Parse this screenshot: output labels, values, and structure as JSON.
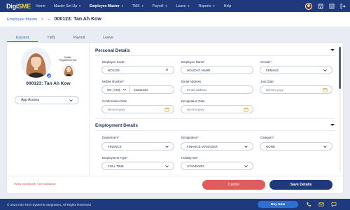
{
  "app": {
    "logo_prefix": "Digi",
    "logo_suffix": "SME",
    "colors": {
      "nav": "#1f3a7c",
      "accent": "#2d6fd3",
      "cancel": "#e05c5c",
      "required": "#d94242"
    }
  },
  "nav": {
    "items": [
      {
        "label": "Home",
        "has_caret": false
      },
      {
        "label": "Master Set Up",
        "has_caret": true
      },
      {
        "label": "Employee Master",
        "has_caret": true,
        "active": true
      },
      {
        "label": "TMS",
        "has_caret": true
      },
      {
        "label": "Payroll",
        "has_caret": true
      },
      {
        "label": "Leave",
        "has_caret": true
      },
      {
        "label": "Reports",
        "has_caret": true
      },
      {
        "label": "Help",
        "has_caret": false
      }
    ],
    "right_icons": [
      "user-avatar",
      "building-icon",
      "list-icon",
      "logout-icon"
    ]
  },
  "breadcrumb": {
    "parent": "Employee Master",
    "separator": ">",
    "title": "000123: Tan Ah Kow"
  },
  "tabs": [
    {
      "label": "Expand",
      "active": true
    },
    {
      "label": "TMS"
    },
    {
      "label": "Payroll"
    },
    {
      "label": "Leave"
    }
  ],
  "profile": {
    "reg_label": "Mobile Registered Face",
    "name": "000123: Tan Ah Kow",
    "app_access": "App Access"
  },
  "personal": {
    "title": "Personal Details",
    "employee_code": {
      "label": "Employee Code",
      "value": "NO1234"
    },
    "employee_name": {
      "label": "Employee Name",
      "value": "HOLIDAY NAME"
    },
    "gender": {
      "label": "Gender",
      "value": "FEMALE"
    },
    "mobile": {
      "label": "Mobile Number",
      "code": "SG (+65)",
      "value": "12341234"
    },
    "email": {
      "label": "Email Address",
      "placeholder": "Email address"
    },
    "join_date": {
      "label": "Join Date",
      "placeholder": "dd-mm-yyyy"
    },
    "confirmation_date": {
      "label": "Confirmation Date",
      "placeholder": "dd-mm-yyyy"
    },
    "resignation_date": {
      "label": "Resignation Date",
      "placeholder": "dd-mm-yyyy"
    }
  },
  "employment": {
    "title": "Employment Details",
    "department": {
      "label": "Department",
      "value": "FINANCE"
    },
    "designation": {
      "label": "Designation",
      "value": "FINANCE MANAGER"
    },
    "category": {
      "label": "Category",
      "value": "NONE"
    },
    "employment_type": {
      "label": "Employment Type",
      "value": "FULL TIME"
    },
    "holiday_set": {
      "label": "Holiday Set",
      "value": "STANDARD"
    }
  },
  "form_footer": {
    "note": "Fields marked with * are mandatory",
    "cancel": "Cancel",
    "save": "Save Details"
  },
  "page_footer": {
    "copyright": "© 2022 Info-Tech Systems Integrators, All Rights Reserved",
    "buy_now": "Buy Now"
  }
}
